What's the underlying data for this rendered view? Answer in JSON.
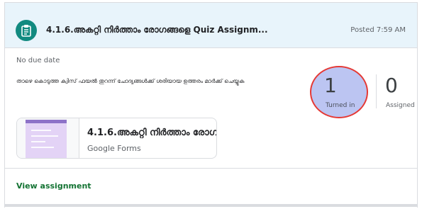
{
  "assignment": {
    "title": "4.1.6.അകറ്റി നിർത്താം രോഗങ്ങളെ Quiz Assignm...",
    "posted": "Posted 7:59 AM",
    "due": "No due date",
    "instructions": "താഴെ കൊടുത്ത ക്വിസ് ഫയൽ തുറന്ന് ചോദ്യങ്ങൾക്ക് ശരിയായ ഉത്തരം മാർക്ക് ചെയ്യുക"
  },
  "stats": {
    "turned_in_count": "1",
    "turned_in_label": "Turned in",
    "assigned_count": "0",
    "assigned_label": "Assigned"
  },
  "attachment": {
    "title": "4.1.6.അകറ്റി നിർത്താം രോഗ...",
    "subtitle": "Google Forms"
  },
  "footer": {
    "view_assignment": "View assignment"
  },
  "colors": {
    "header_background": "#e8f4fb",
    "icon_background": "#128a80",
    "highlight_fill": "#bcc5f2",
    "highlight_border": "#e53935",
    "link_green": "#137333",
    "forms_purple": "#8d72c8"
  },
  "icons": {
    "assignment": "assignment-icon",
    "form_preview": "form-thumbnail-icon"
  }
}
